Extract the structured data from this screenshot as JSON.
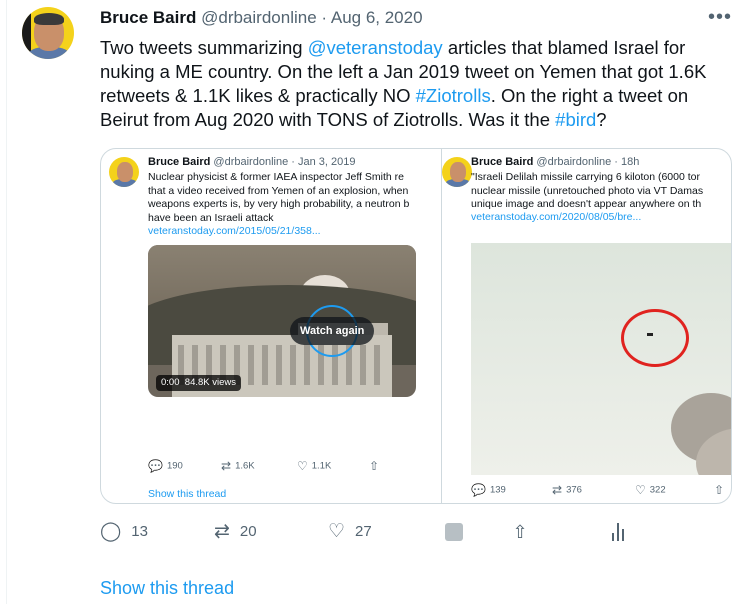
{
  "tweet": {
    "author_name": "Bruce Baird",
    "author_handle": "@drbairdonline",
    "separator": "·",
    "date": "Aug 6, 2020",
    "text_parts": {
      "p1": "Two tweets summarizing ",
      "mention": "@veteranstoday",
      "p2": " articles that blamed Israel for nuking a ME country. On the left a Jan 2019 tweet on Yemen that got 1.6K retweets & 1.1K likes & practically NO ",
      "hashtag1": "#Ziotrolls",
      "p3": ". On the right a tweet on Beirut from Aug 2020 with TONS of Ziotrolls. Was it the ",
      "hashtag2": "#bird",
      "p4": "?"
    },
    "more_icon": "more-icon",
    "colors": {
      "link": "#1d9bf0",
      "text": "#0f1419",
      "muted": "#536471",
      "circle": "#e0231f"
    }
  },
  "embed_left": {
    "name": "Bruce Baird",
    "handle_date": "@drbairdonline · Jan 3, 2019",
    "text_lines": [
      "Nuclear physicist & former IAEA inspector Jeff Smith re",
      "that a video received from Yemen of an explosion, when",
      "weapons experts is, by very high probability, a neutron b",
      "have been an Israeli attack"
    ],
    "link": "veteranstoday.com/2015/05/21/358...",
    "watch_label": "Watch again",
    "time": "0:00",
    "views": "84.8K views",
    "replies": "190",
    "retweets": "1.6K",
    "likes": "1.1K",
    "show_thread": "Show this thread"
  },
  "embed_right": {
    "name": "Bruce Baird",
    "handle_date": "@drbairdonline · 18h",
    "text_lines": [
      "\"Israeli Delilah missile carrying 6 kiloton (6000 tor",
      "nuclear missile (unretouched photo via VT Damas",
      "unique image and doesn't appear anywhere on th"
    ],
    "link": "veteranstoday.com/2020/08/05/bre...",
    "replies": "139",
    "retweets": "376",
    "likes": "322"
  },
  "actions": {
    "replies": "13",
    "retweets": "20",
    "likes": "27"
  },
  "show_thread": "Show this thread"
}
